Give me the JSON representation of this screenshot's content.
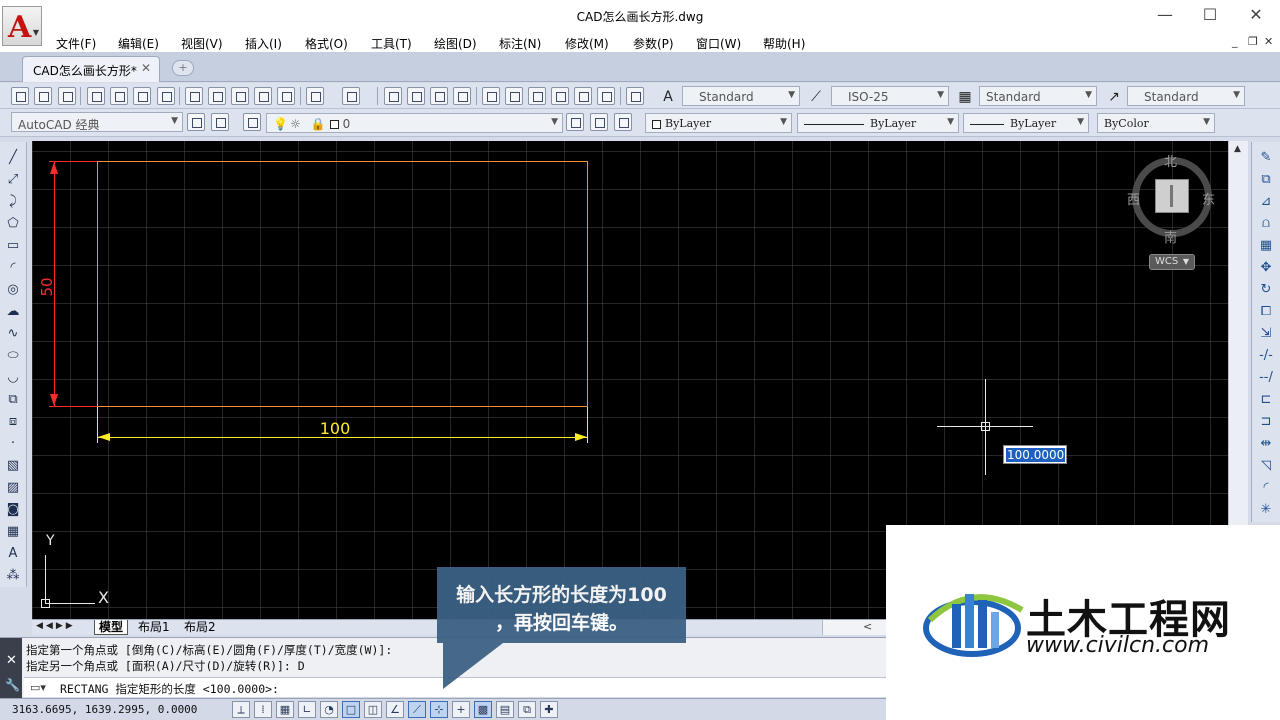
{
  "window": {
    "title": "CAD怎么画长方形.dwg",
    "controls": {
      "minimize": "—",
      "maximize": "☐",
      "close": "✕"
    }
  },
  "menu": [
    "文件(F)",
    "编辑(E)",
    "视图(V)",
    "插入(I)",
    "格式(O)",
    "工具(T)",
    "绘图(D)",
    "标注(N)",
    "修改(M)",
    "参数(P)",
    "窗口(W)",
    "帮助(H)"
  ],
  "document_tab": {
    "label": "CAD怎么画长方形*",
    "close": "✕"
  },
  "styles": {
    "text_style": "Standard",
    "dim_style": "ISO-25",
    "table_style": "Standard",
    "multileader_style": "Standard"
  },
  "workspace": "AutoCAD 经典",
  "layer": {
    "current": "0"
  },
  "properties": {
    "color": "ByLayer",
    "linetype": "ByLayer",
    "lineweight": "ByLayer",
    "plotstyle": "ByColor"
  },
  "drawing": {
    "dim_horizontal": "100",
    "dim_vertical": "50",
    "dynamic_input_value": "100.0000"
  },
  "viewcube": {
    "north": "北",
    "south": "南",
    "east": "东",
    "west": "西",
    "wcs": "WCS"
  },
  "ucs": {
    "x": "X",
    "y": "Y"
  },
  "layout_tabs": [
    "模型",
    "布局1",
    "布局2"
  ],
  "command": {
    "history": [
      "指定第一个角点或 [倒角(C)/标高(E)/圆角(F)/厚度(T)/宽度(W)]:",
      "指定另一个角点或 [面积(A)/尺寸(D)/旋转(R)]: D"
    ],
    "prompt": "RECTANG 指定矩形的长度 <100.0000>:"
  },
  "status": {
    "coords": "3163.6695, 1639.2995, 0.0000"
  },
  "callout": {
    "line1": "输入长方形的长度为100",
    "line2": "，再按回车键。"
  },
  "watermark": {
    "title": "土木工程网",
    "url": "www.civilcn.com"
  },
  "colors": {
    "rectangle": "#ff8c3c",
    "vertical_dimension": "#ff2a2a",
    "horizontal_dimension": "#ffee22",
    "callout_bg": "#3c6184"
  }
}
